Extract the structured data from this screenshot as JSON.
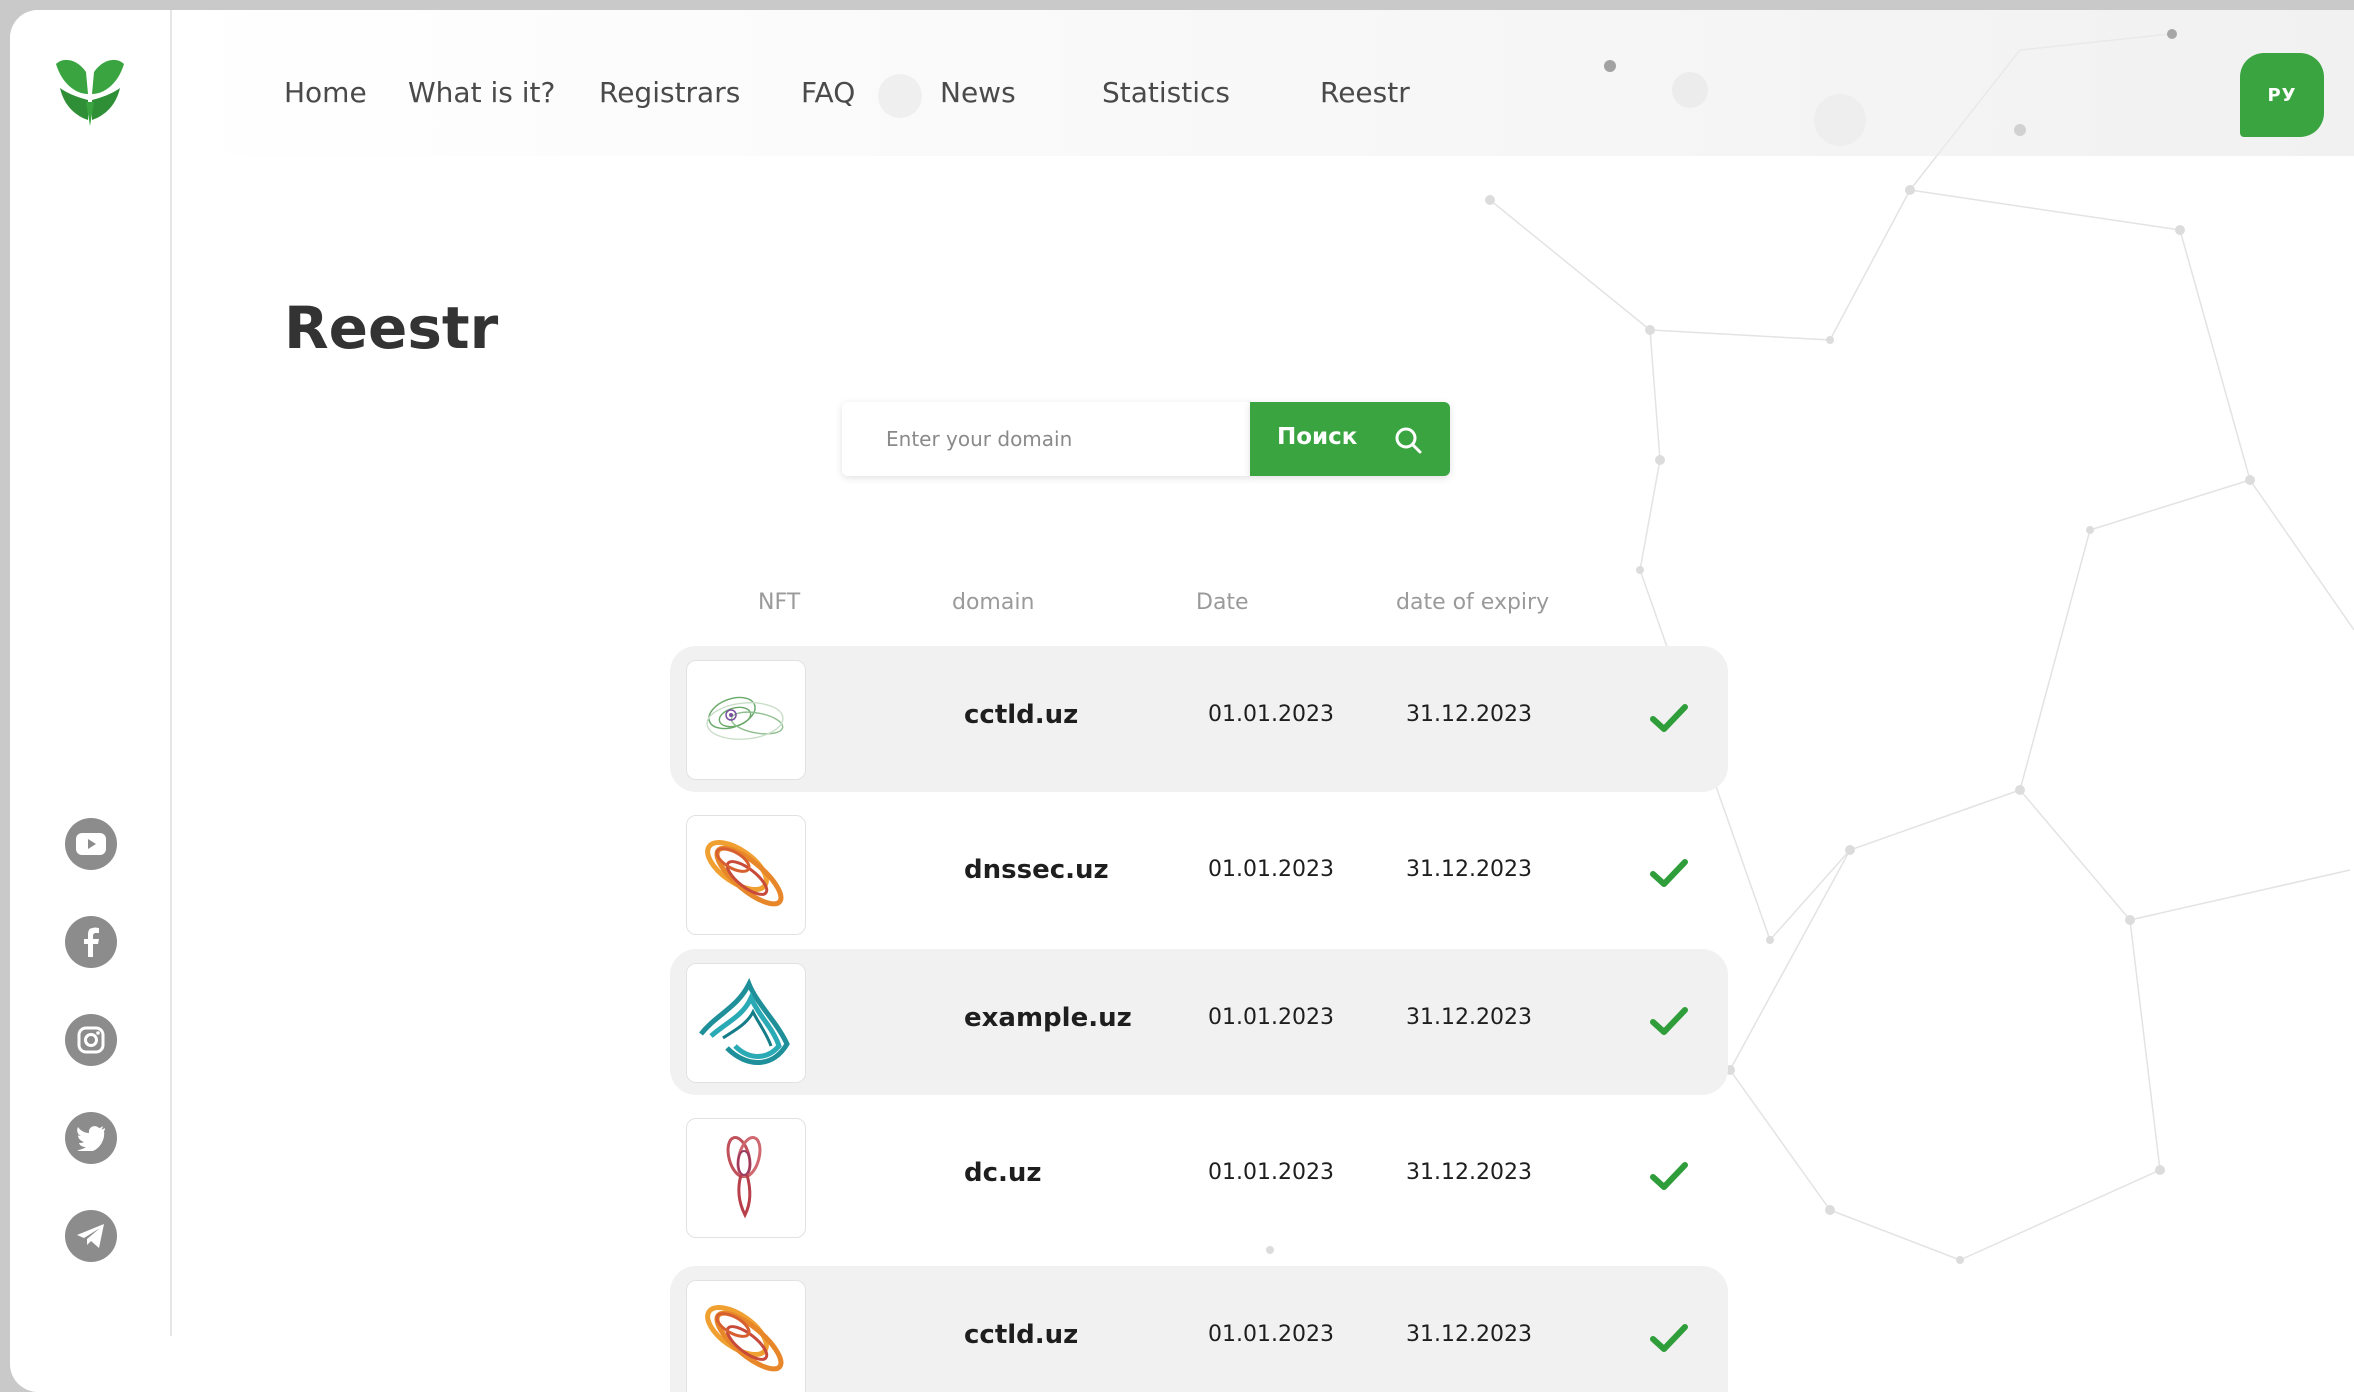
{
  "nav": {
    "items": [
      {
        "label": "Home"
      },
      {
        "label": "What is it?"
      },
      {
        "label": "Registrars"
      },
      {
        "label": "FAQ"
      },
      {
        "label": "News"
      },
      {
        "label": "Statistics"
      },
      {
        "label": "Reestr"
      }
    ],
    "lang_button": "РУ"
  },
  "page": {
    "title": "Reestr"
  },
  "search": {
    "placeholder": "Enter your domain",
    "button_label": "Поиск"
  },
  "table": {
    "headers": [
      "NFT",
      "domain",
      "Date",
      "date of expiry"
    ],
    "rows": [
      {
        "domain": "cctld.uz",
        "date": "01.01.2023",
        "expiry": "31.12.2023",
        "nft": "green-attractor"
      },
      {
        "domain": "dnssec.uz",
        "date": "01.01.2023",
        "expiry": "31.12.2023",
        "nft": "orange-attractor"
      },
      {
        "domain": "example.uz",
        "date": "01.01.2023",
        "expiry": "31.12.2023",
        "nft": "teal-attractor"
      },
      {
        "domain": "dc.uz",
        "date": "01.01.2023",
        "expiry": "31.12.2023",
        "nft": "red-attractor"
      },
      {
        "domain": "cctld.uz",
        "date": "01.01.2023",
        "expiry": "31.12.2023",
        "nft": "orange-attractor"
      }
    ]
  },
  "social": [
    "youtube-icon",
    "facebook-icon",
    "instagram-icon",
    "twitter-icon",
    "telegram-icon"
  ],
  "colors": {
    "accent": "#3aa540",
    "check": "#2f9e3a",
    "row_shade": "#f1f1f1"
  }
}
